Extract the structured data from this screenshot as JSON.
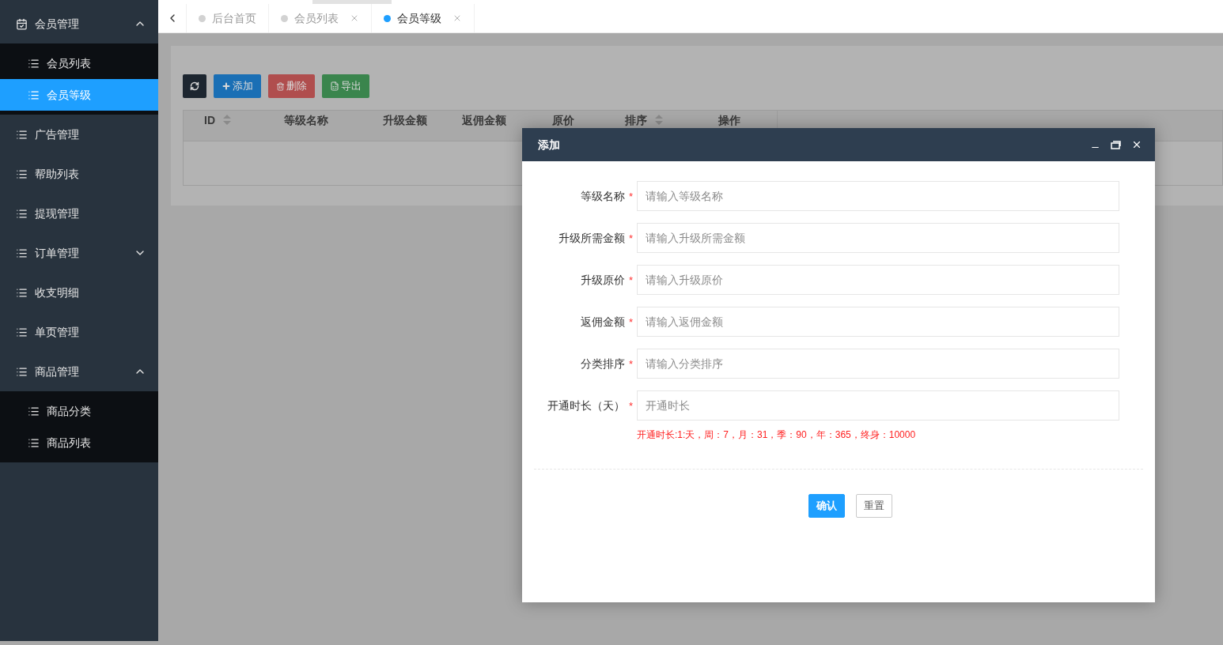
{
  "sidebar": {
    "items": [
      {
        "label": "会员管理",
        "expanded": true,
        "children": [
          {
            "label": "会员列表",
            "selected": false
          },
          {
            "label": "会员等级",
            "selected": true
          }
        ]
      },
      {
        "label": "广告管理"
      },
      {
        "label": "帮助列表"
      },
      {
        "label": "提现管理"
      },
      {
        "label": "订单管理",
        "expanded": false
      },
      {
        "label": "收支明细"
      },
      {
        "label": "单页管理"
      },
      {
        "label": "商品管理",
        "expanded": true,
        "children": [
          {
            "label": "商品分类",
            "selected": false
          },
          {
            "label": "商品列表",
            "selected": false
          }
        ]
      }
    ]
  },
  "tabs": [
    {
      "label": "后台首页",
      "selected": false,
      "closable": false
    },
    {
      "label": "会员列表",
      "selected": false,
      "closable": true
    },
    {
      "label": "会员等级",
      "selected": true,
      "closable": true
    }
  ],
  "toolbar": [
    {
      "kind": "refresh"
    },
    {
      "kind": "add",
      "label": "添加"
    },
    {
      "kind": "delete",
      "label": "删除"
    },
    {
      "kind": "export",
      "label": "导出"
    }
  ],
  "table": {
    "columns": [
      {
        "label": "ID",
        "sortable": true
      },
      {
        "label": "等级名称",
        "sortable": false
      },
      {
        "label": "升级金额",
        "sortable": false
      },
      {
        "label": "返佣金额",
        "sortable": false
      },
      {
        "label": "原价",
        "sortable": false
      },
      {
        "label": "排序",
        "sortable": true
      },
      {
        "label": "操作",
        "sortable": false
      }
    ]
  },
  "dialog": {
    "title": "添加",
    "fields": [
      {
        "label": "等级名称",
        "required_mark": "*",
        "placeholder": "请输入等级名称"
      },
      {
        "label": "升级所需金额",
        "required_mark": "*",
        "placeholder": "请输入升级所需金额"
      },
      {
        "label": "升级原价",
        "required_mark": "*",
        "placeholder": "请输入升级原价"
      },
      {
        "label": "返佣金额",
        "required_mark": "*",
        "placeholder": "请输入返佣金额"
      },
      {
        "label": "分类排序",
        "required_mark": "*",
        "placeholder": "请输入分类排序"
      },
      {
        "label": "开通时长（天）",
        "required_mark": "*",
        "placeholder": "开通时长"
      }
    ],
    "hint": "开通时长:1:天，周：7，月：31，季：90，年：365，终身：10000",
    "buttons": [
      {
        "kind": "primary",
        "label": "确认"
      },
      {
        "kind": "plain",
        "label": "重置"
      }
    ]
  }
}
